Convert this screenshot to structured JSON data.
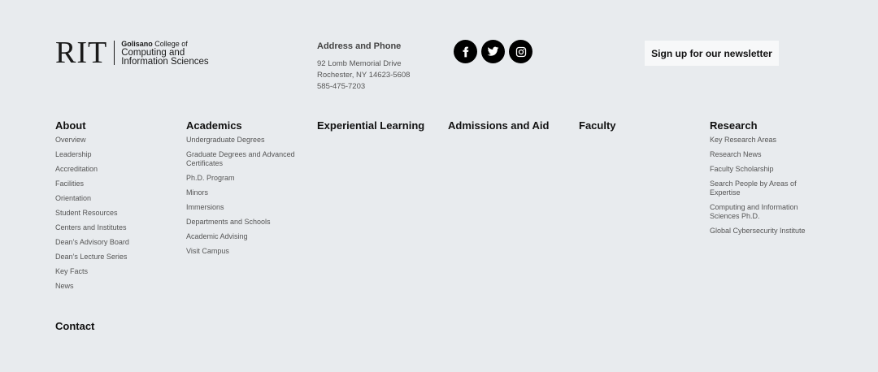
{
  "logo": {
    "rit": "RIT",
    "line1_bold": "Golisano",
    "line1_rest": " College of",
    "line2": "Computing and",
    "line3": "Information Sciences"
  },
  "address": {
    "title": "Address and Phone",
    "street": "92 Lomb Memorial Drive",
    "city": "Rochester, NY 14623-5608",
    "phone": "585-475-7203"
  },
  "social": [
    {
      "name": "facebook-icon"
    },
    {
      "name": "twitter-icon"
    },
    {
      "name": "instagram-icon"
    }
  ],
  "newsletter": {
    "label": "Sign up for our newsletter"
  },
  "columns": [
    {
      "heading": "About",
      "links": [
        "Overview",
        "Leadership",
        "Accreditation",
        "Facilities",
        "Orientation",
        "Student Resources",
        "Centers and Institutes",
        "Dean’s Advisory Board",
        "Dean’s Lecture Series",
        "Key Facts",
        "News"
      ]
    },
    {
      "heading": "Academics",
      "links": [
        "Undergraduate Degrees",
        "Graduate Degrees and Advanced Certificates",
        "Ph.D. Program",
        "Minors",
        "Immersions",
        "Departments and Schools",
        "Academic Advising",
        "Visit Campus"
      ]
    },
    {
      "heading": "Experiential Learning",
      "links": []
    },
    {
      "heading": "Admissions and Aid",
      "links": []
    },
    {
      "heading": "Faculty",
      "links": []
    },
    {
      "heading": "Research",
      "links": [
        "Key Research Areas",
        "Research News",
        "Faculty Scholarship",
        "Search People by Areas of Expertise",
        "Computing and Information Sciences Ph.D.",
        "Global Cybersecurity Institute"
      ]
    }
  ],
  "contact": {
    "heading": "Contact"
  }
}
